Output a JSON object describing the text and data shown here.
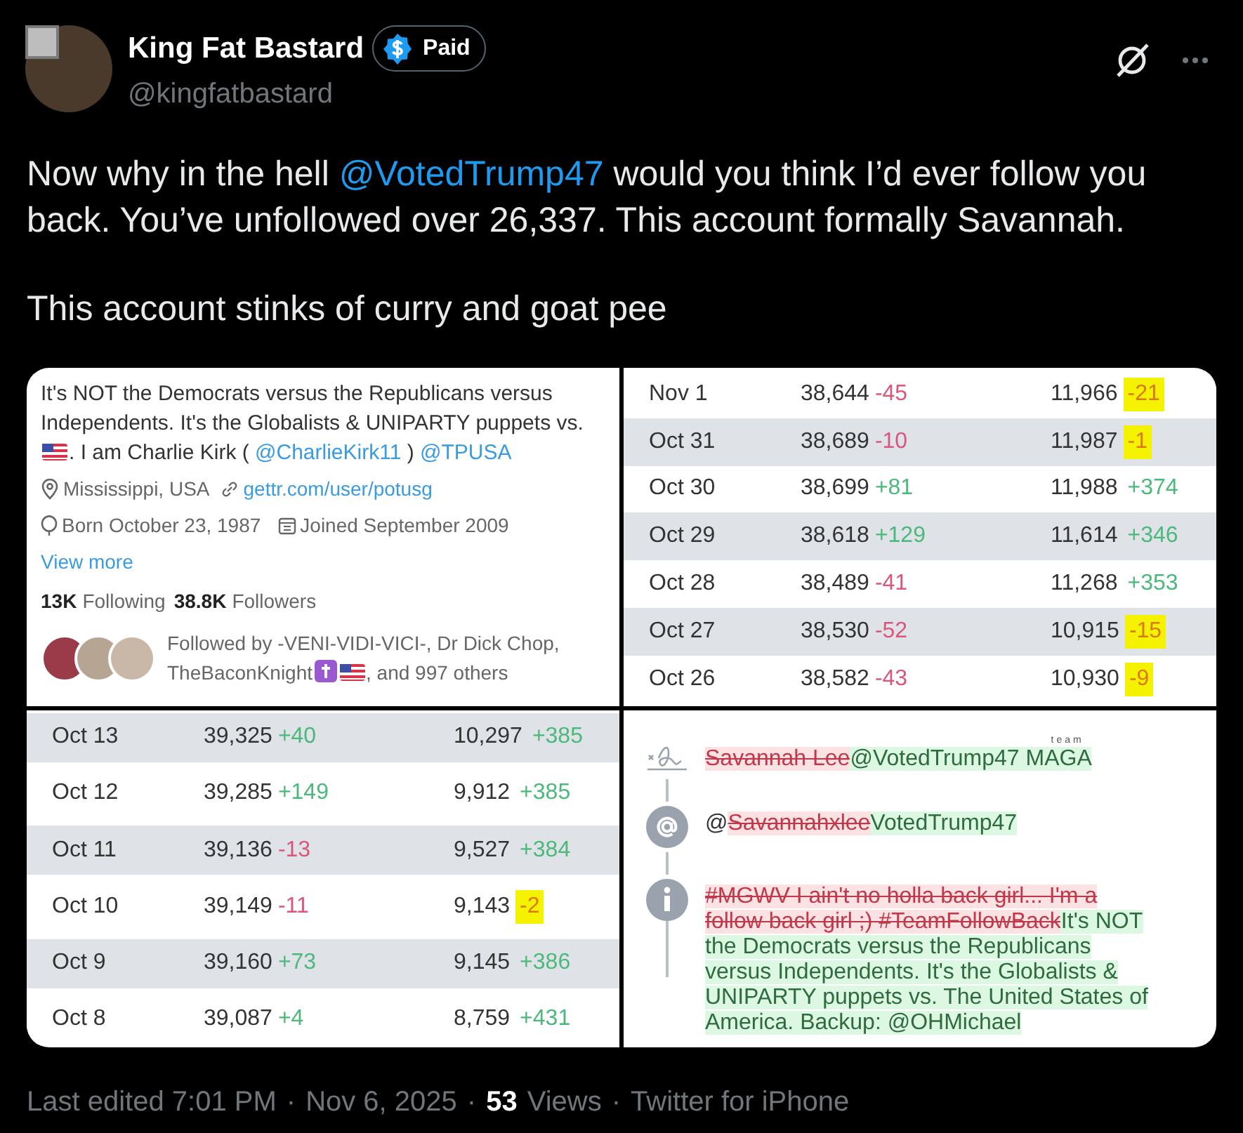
{
  "author": {
    "name": "King Fat Bastard",
    "badge": "Paid",
    "handle": "@kingfatbastard"
  },
  "selection_checkbox": {
    "checked": false
  },
  "body": [
    [
      {
        "kind": "text",
        "text": "Now why in the hell "
      },
      {
        "kind": "link",
        "text": "@VotedTrump47"
      },
      {
        "kind": "text",
        "text": " would you think I’d ever follow you back. You’ve unfollowed over 26,337. This account formally Savannah."
      }
    ],
    [
      {
        "kind": "text",
        "text": "This account stinks of curry and goat pee"
      }
    ]
  ],
  "profile_card": {
    "bio": [
      {
        "kind": "text",
        "text": "It's NOT the Democrats versus the Republicans versus Independents. It's the Globalists & UNIPARTY puppets vs. "
      },
      {
        "kind": "flag"
      },
      {
        "kind": "text",
        "text": ". I am Charlie Kirk ( "
      },
      {
        "kind": "link",
        "text": "@CharlieKirk11"
      },
      {
        "kind": "text",
        "text": " ) "
      },
      {
        "kind": "link",
        "text": "@TPUSA"
      }
    ],
    "location": "Mississippi, USA",
    "website": "gettr.com/user/potusg",
    "born": "Born October 23, 1987",
    "joined": "Joined September 2009",
    "view_more": "View more",
    "following_count": "13K",
    "following_label": "Following",
    "followers_count": "38.8K",
    "followers_label": "Followers",
    "followed_by": [
      {
        "kind": "text",
        "text": "Followed by -VENI-VIDI-VICI-, Dr Dick Chop, TheBaconKnight"
      },
      {
        "kind": "cross"
      },
      {
        "kind": "flag"
      },
      {
        "kind": "text",
        "text": ", and 997 others"
      }
    ]
  },
  "table_top": [
    {
      "date": "Nov 1",
      "count": "38,644",
      "change": "-45",
      "gain": false,
      "count_2": "11,966",
      "change_2": "-21",
      "gain_2": false,
      "highlighted": true
    },
    {
      "date": "Oct 31",
      "count": "38,689",
      "change": "-10",
      "gain": false,
      "count_2": "11,987",
      "change_2": "-1",
      "gain_2": false,
      "highlighted": true
    },
    {
      "date": "Oct 30",
      "count": "38,699",
      "change": "+81",
      "gain": true,
      "count_2": "11,988",
      "change_2": "+374",
      "gain_2": true,
      "highlighted": false
    },
    {
      "date": "Oct 29",
      "count": "38,618",
      "change": "+129",
      "gain": true,
      "count_2": "11,614",
      "change_2": "+346",
      "gain_2": true,
      "highlighted": false
    },
    {
      "date": "Oct 28",
      "count": "38,489",
      "change": "-41",
      "gain": false,
      "count_2": "11,268",
      "change_2": "+353",
      "gain_2": true,
      "highlighted": false
    },
    {
      "date": "Oct 27",
      "count": "38,530",
      "change": "-52",
      "gain": false,
      "count_2": "10,915",
      "change_2": "-15",
      "gain_2": false,
      "highlighted": true
    },
    {
      "date": "Oct 26",
      "count": "38,582",
      "change": "-43",
      "gain": false,
      "count_2": "10,930",
      "change_2": "-9",
      "gain_2": false,
      "highlighted": true
    }
  ],
  "table_bottom": [
    {
      "date": "Oct 13",
      "count": "39,325",
      "change": "+40",
      "gain": true,
      "count_2": "10,297",
      "change_2": "+385",
      "gain_2": true,
      "highlighted": false
    },
    {
      "date": "Oct 12",
      "count": "39,285",
      "change": "+149",
      "gain": true,
      "count_2": "9,912",
      "change_2": "+385",
      "gain_2": true,
      "highlighted": false
    },
    {
      "date": "Oct 11",
      "count": "39,136",
      "change": "-13",
      "gain": false,
      "count_2": "9,527",
      "change_2": "+384",
      "gain_2": true,
      "highlighted": false
    },
    {
      "date": "Oct 10",
      "count": "39,149",
      "change": "-11",
      "gain": false,
      "count_2": "9,143",
      "change_2": "-2",
      "gain_2": false,
      "highlighted": true
    },
    {
      "date": "Oct 9",
      "count": "39,160",
      "change": "+73",
      "gain": true,
      "count_2": "9,145",
      "change_2": "+386",
      "gain_2": true,
      "highlighted": false
    },
    {
      "date": "Oct 8",
      "count": "39,087",
      "change": "+4",
      "gain": true,
      "count_2": "8,759",
      "change_2": "+431",
      "gain_2": true,
      "highlighted": false
    }
  ],
  "history": [
    {
      "kind": "name",
      "segments": [
        {
          "kind": "removed",
          "text": "Savannah Lee"
        },
        {
          "kind": "added",
          "text": "@VotedTrump47 "
        },
        {
          "kind": "added",
          "text": "MAGA",
          "over": "team"
        }
      ]
    },
    {
      "kind": "handle",
      "segments": [
        {
          "kind": "plain",
          "text": "@"
        },
        {
          "kind": "removed",
          "text": "Savannahxlee"
        },
        {
          "kind": "added",
          "text": "VotedTrump47"
        }
      ]
    },
    {
      "kind": "bio",
      "segments": [
        {
          "kind": "removed",
          "text": "#MGWV I ain't no holla back girl... I'm a follow back girl ;) #TeamFollowBack"
        },
        {
          "kind": "added",
          "text": "It's NOT the Democrats versus the Republicans versus Independents. It's the Globalists & UNIPARTY puppets vs. The United States of America. Backup: @OHMichael"
        }
      ]
    }
  ],
  "footer": [
    {
      "kind": "text",
      "text": "Last edited 7:01 PM"
    },
    {
      "kind": "dot",
      "text": "·"
    },
    {
      "kind": "text",
      "text": "Nov 6, 2025"
    },
    {
      "kind": "dot",
      "text": "·"
    },
    {
      "kind": "strong",
      "text": "53"
    },
    {
      "kind": "text",
      "text": "Views"
    },
    {
      "kind": "dot",
      "text": "·"
    },
    {
      "kind": "text",
      "text": "Twitter for iPhone"
    }
  ]
}
